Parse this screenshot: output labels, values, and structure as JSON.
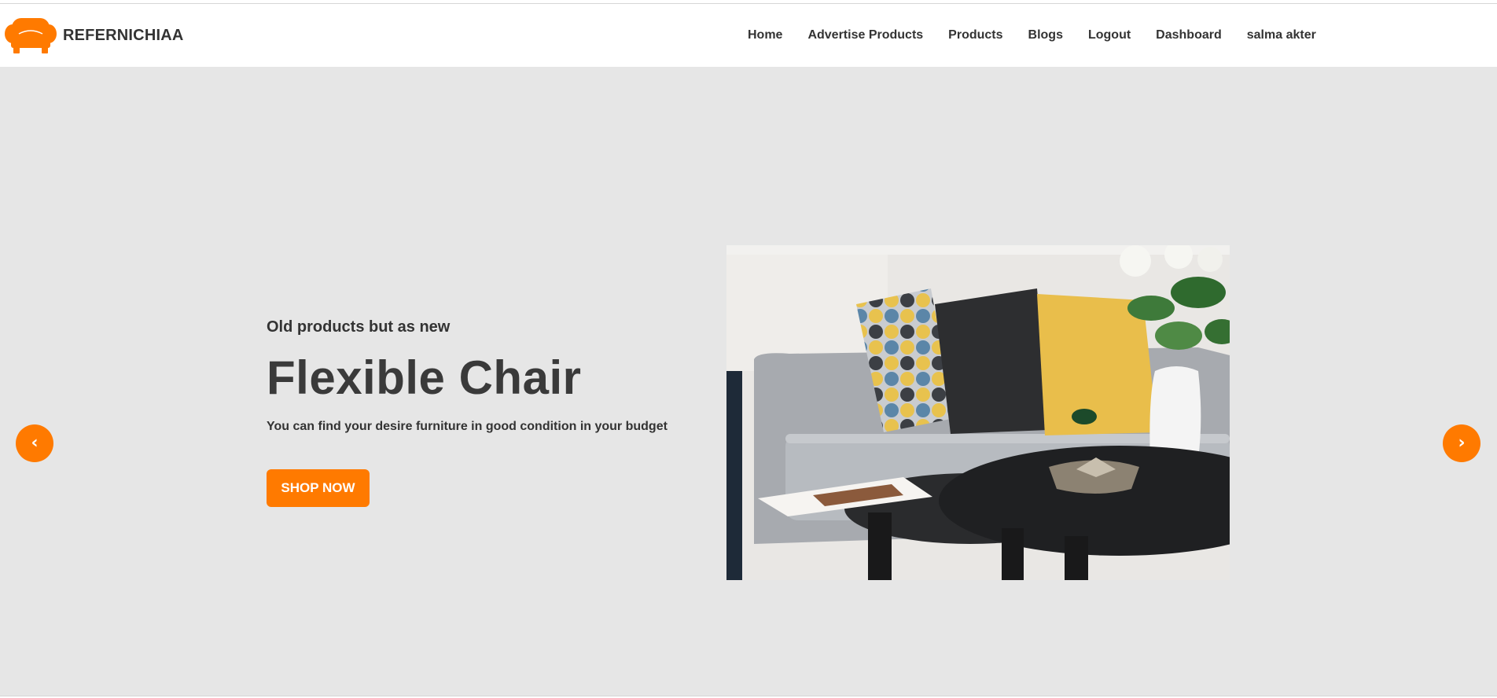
{
  "brand": {
    "name": "REFERNICHIAA",
    "logo_icon": "armchair-icon",
    "accent_color": "#ff7a00"
  },
  "nav": {
    "items": [
      "Home",
      "Advertise Products",
      "Products",
      "Blogs",
      "Logout",
      "Dashboard",
      "salma akter"
    ]
  },
  "hero": {
    "eyebrow": "Old products but as new",
    "title": "Flexible Chair",
    "subtitle": "You can find your desire furniture in good condition in your budget",
    "cta_label": "SHOP NOW",
    "background": "#e6e6e6",
    "image_description_icon": "sofa-photo"
  },
  "carousel": {
    "prev_glyph": "‹",
    "next_glyph": "›",
    "prev_icon": "chevron-left-icon",
    "next_icon": "chevron-right-icon"
  }
}
